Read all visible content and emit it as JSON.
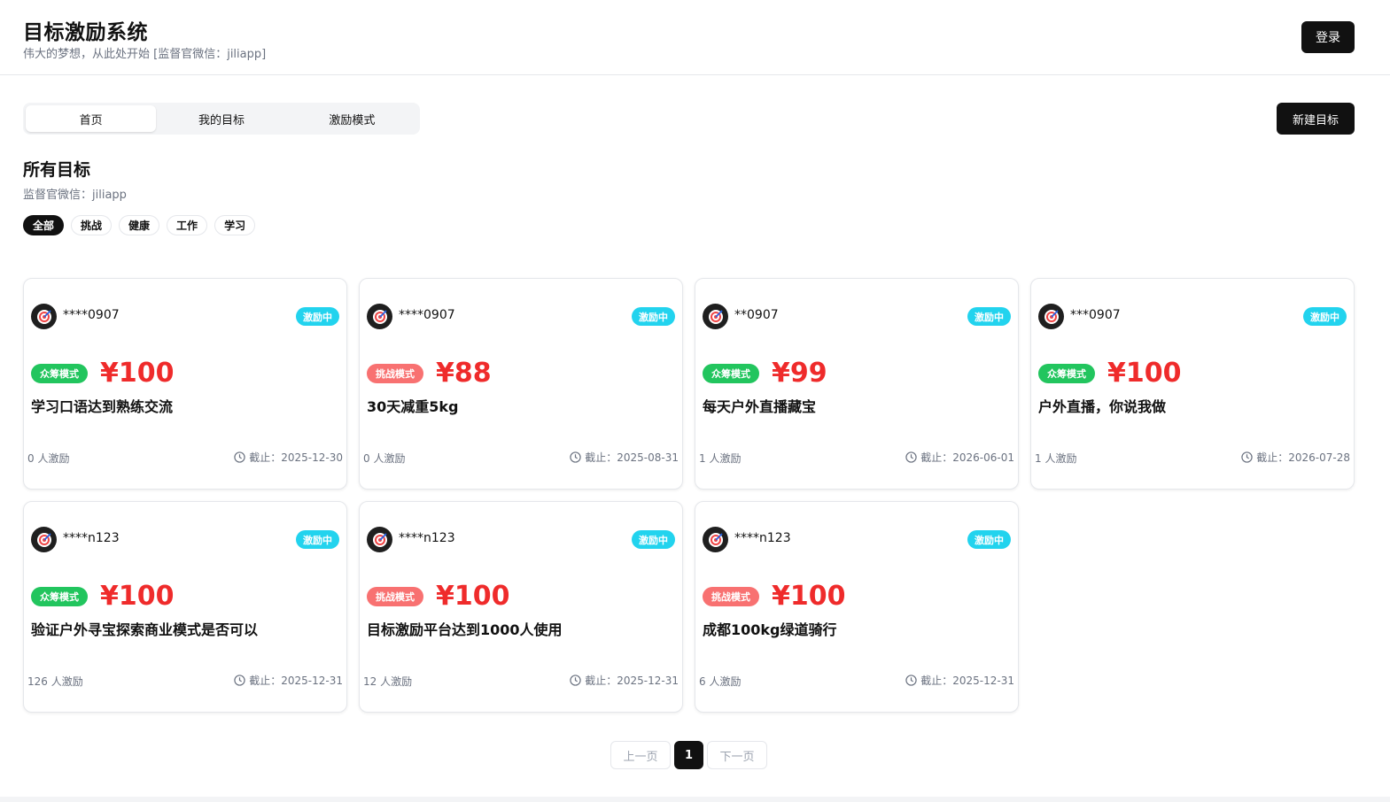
{
  "header": {
    "title": "目标激励系统",
    "subtitle": "伟大的梦想，从此处开始 [监督官微信：jiliapp]",
    "login_label": "登录"
  },
  "tabs": [
    {
      "label": "首页",
      "active": true
    },
    {
      "label": "我的目标",
      "active": false
    },
    {
      "label": "激励模式",
      "active": false
    }
  ],
  "new_goal_label": "新建目标",
  "section": {
    "title": "所有目标",
    "subtitle": "监督官微信：jiliapp"
  },
  "filters": [
    {
      "label": "全部",
      "active": true
    },
    {
      "label": "挑战",
      "active": false
    },
    {
      "label": "健康",
      "active": false
    },
    {
      "label": "工作",
      "active": false
    },
    {
      "label": "学习",
      "active": false
    }
  ],
  "goals": [
    {
      "user": "****0907",
      "status": "激励中",
      "mode": "众筹模式",
      "mode_type": "crowd",
      "amount": "¥100",
      "title": "学习口语达到熟练交流",
      "supporters": "0 人激励",
      "deadline": "截止：2025-12-30"
    },
    {
      "user": "****0907",
      "status": "激励中",
      "mode": "挑战模式",
      "mode_type": "challenge",
      "amount": "¥88",
      "title": "30天减重5kg",
      "supporters": "0 人激励",
      "deadline": "截止：2025-08-31"
    },
    {
      "user": "**0907",
      "status": "激励中",
      "mode": "众筹模式",
      "mode_type": "crowd",
      "amount": "¥99",
      "title": "每天户外直播藏宝",
      "supporters": "1 人激励",
      "deadline": "截止：2026-06-01"
    },
    {
      "user": "***0907",
      "status": "激励中",
      "mode": "众筹模式",
      "mode_type": "crowd",
      "amount": "¥100",
      "title": "户外直播，你说我做",
      "supporters": "1 人激励",
      "deadline": "截止：2026-07-28"
    },
    {
      "user": "****n123",
      "status": "激励中",
      "mode": "众筹模式",
      "mode_type": "crowd",
      "amount": "¥100",
      "title": "验证户外寻宝探索商业模式是否可以",
      "supporters": "126 人激励",
      "deadline": "截止：2025-12-31"
    },
    {
      "user": "****n123",
      "status": "激励中",
      "mode": "挑战模式",
      "mode_type": "challenge",
      "amount": "¥100",
      "title": "目标激励平台达到1000人使用",
      "supporters": "12 人激励",
      "deadline": "截止：2025-12-31"
    },
    {
      "user": "****n123",
      "status": "激励中",
      "mode": "挑战模式",
      "mode_type": "challenge",
      "amount": "¥100",
      "title": "成都100kg绿道骑行",
      "supporters": "6 人激励",
      "deadline": "截止：2025-12-31"
    }
  ],
  "pagination": {
    "prev_label": "上一页",
    "current_page": "1",
    "next_label": "下一页"
  },
  "colors": {
    "accent_dark": "#111111",
    "status_badge": "#22d3ee",
    "crowd_mode": "#22c55e",
    "challenge_mode": "#f87171",
    "amount": "#ef2b2b"
  }
}
